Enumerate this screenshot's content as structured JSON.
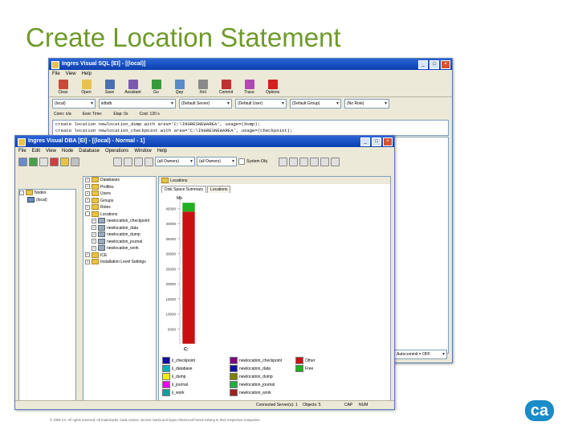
{
  "slide": {
    "title": "Create Location Statement",
    "footer": "© 2008 CA. All rights reserved. All trademarks, trade names, service marks and logos referenced herein belong to their respective companies.",
    "logo": "ca"
  },
  "sql_window": {
    "title": "Ingres Visual SQL [EI] - [(local)]",
    "menu": [
      "File",
      "View",
      "Help"
    ],
    "toolbar": [
      {
        "label": "Clear",
        "icon": "eraser-icon",
        "color": "#c94a3a"
      },
      {
        "label": "Open",
        "icon": "folder-icon",
        "color": "#e8c34a"
      },
      {
        "label": "Save",
        "icon": "disk-icon",
        "color": "#4a6fb0"
      },
      {
        "label": "Assistant",
        "icon": "wand-icon",
        "color": "#7a5ab0"
      },
      {
        "label": "Go",
        "icon": "go-icon",
        "color": "#3a9a3a"
      },
      {
        "label": "Qep",
        "icon": "qep-icon",
        "color": "#5a8ac8"
      },
      {
        "label": "Xml",
        "icon": "xml-icon",
        "color": "#8a8a8a"
      },
      {
        "label": "Commit",
        "icon": "commit-icon",
        "color": "#c03030"
      },
      {
        "label": "Trace",
        "icon": "trace-icon",
        "color": "#b04ab0"
      },
      {
        "label": "Options",
        "icon": "check-icon",
        "color": "#d02020"
      }
    ],
    "combos": [
      "(local)",
      "iidbdb",
      "(Default Server)",
      "(Default User)",
      "(Default Group)",
      "(No Role)"
    ],
    "status": [
      "Conn: n/a",
      "Exec Time:",
      "Elap: 0s",
      "Cost: 120 s"
    ],
    "sql_lines": [
      "create location newlocation_dump with area='C:\\INGRESNEWAREA', usage=(dump);",
      "create location newlocation_checkpoint with area='C:\\INGRESNEWAREA', usage=(checkpoint);"
    ],
    "autocommit": "Autocommit = OFF"
  },
  "dba_window": {
    "title": "Ingres Visual DBA [EI] - [(local) - Normal - 1]",
    "menu": [
      "File",
      "Edit",
      "View",
      "Node",
      "Database",
      "Operations",
      "Window",
      "Help"
    ],
    "combo_a": "(all Owners)",
    "combo_b": "(all Owners)",
    "system_obj": "System Obj",
    "left_tree": [
      {
        "label": "Nodes",
        "level": 0
      },
      {
        "label": "(local)",
        "level": 1
      }
    ],
    "db_tree": [
      {
        "label": "Databases",
        "level": 0,
        "pm": "+"
      },
      {
        "label": "Profiles",
        "level": 0,
        "pm": "+"
      },
      {
        "label": "Users",
        "level": 0,
        "pm": "+"
      },
      {
        "label": "Groups",
        "level": 0,
        "pm": "+"
      },
      {
        "label": "Roles",
        "level": 0,
        "pm": "+"
      },
      {
        "label": "Locations",
        "level": 0,
        "pm": "-"
      },
      {
        "label": "newlocation_checkpoint",
        "level": 1,
        "pm": "+"
      },
      {
        "label": "newlocation_data",
        "level": 1,
        "pm": "+"
      },
      {
        "label": "newlocation_dump",
        "level": 1,
        "pm": "+"
      },
      {
        "label": "newlocation_journal",
        "level": 1,
        "pm": "+"
      },
      {
        "label": "newlocation_work",
        "level": 1,
        "pm": "+"
      },
      {
        "label": "ICE",
        "level": 0,
        "pm": "+"
      },
      {
        "label": "Installation Level Settings",
        "level": 0,
        "pm": "+"
      }
    ],
    "right_header": "Locations",
    "tabs": [
      "Disk Space Summary",
      "Locations"
    ],
    "status_left": "Connected Server(s): 1",
    "status_mid": "Objects: 5",
    "status_caps": [
      "CAP",
      "NUM"
    ],
    "chart_data": {
      "type": "bar",
      "ylabel": "Mb",
      "yticks": [
        "45000",
        "40000",
        "35000",
        "30000",
        "25000",
        "20000",
        "15000",
        "10000",
        "5000"
      ],
      "categories": [
        "C:"
      ],
      "stack_order": [
        "Free",
        "Other"
      ],
      "series": [
        {
          "name": "Other",
          "color": "#c81010",
          "values": [
            44000
          ]
        },
        {
          "name": "Free",
          "color": "#20b020",
          "values": [
            3000
          ]
        }
      ]
    },
    "legend": [
      {
        "label": "ii_checkpoint",
        "color": "#1010a0"
      },
      {
        "label": "ii_database",
        "color": "#00b0c0"
      },
      {
        "label": "ii_dump",
        "color": "#f0f000"
      },
      {
        "label": "ii_journal",
        "color": "#f000f0"
      },
      {
        "label": "ii_work",
        "color": "#10a0a0"
      },
      {
        "label": "newlocation_checkpoint",
        "color": "#800080"
      },
      {
        "label": "newlocation_data",
        "color": "#1010a0"
      },
      {
        "label": "newlocation_dump",
        "color": "#808000"
      },
      {
        "label": "newlocation_journal",
        "color": "#20b040"
      },
      {
        "label": "newlocation_work",
        "color": "#a02020"
      },
      {
        "label": "Other",
        "color": "#c81010"
      },
      {
        "label": "Free",
        "color": "#20b020"
      }
    ]
  }
}
